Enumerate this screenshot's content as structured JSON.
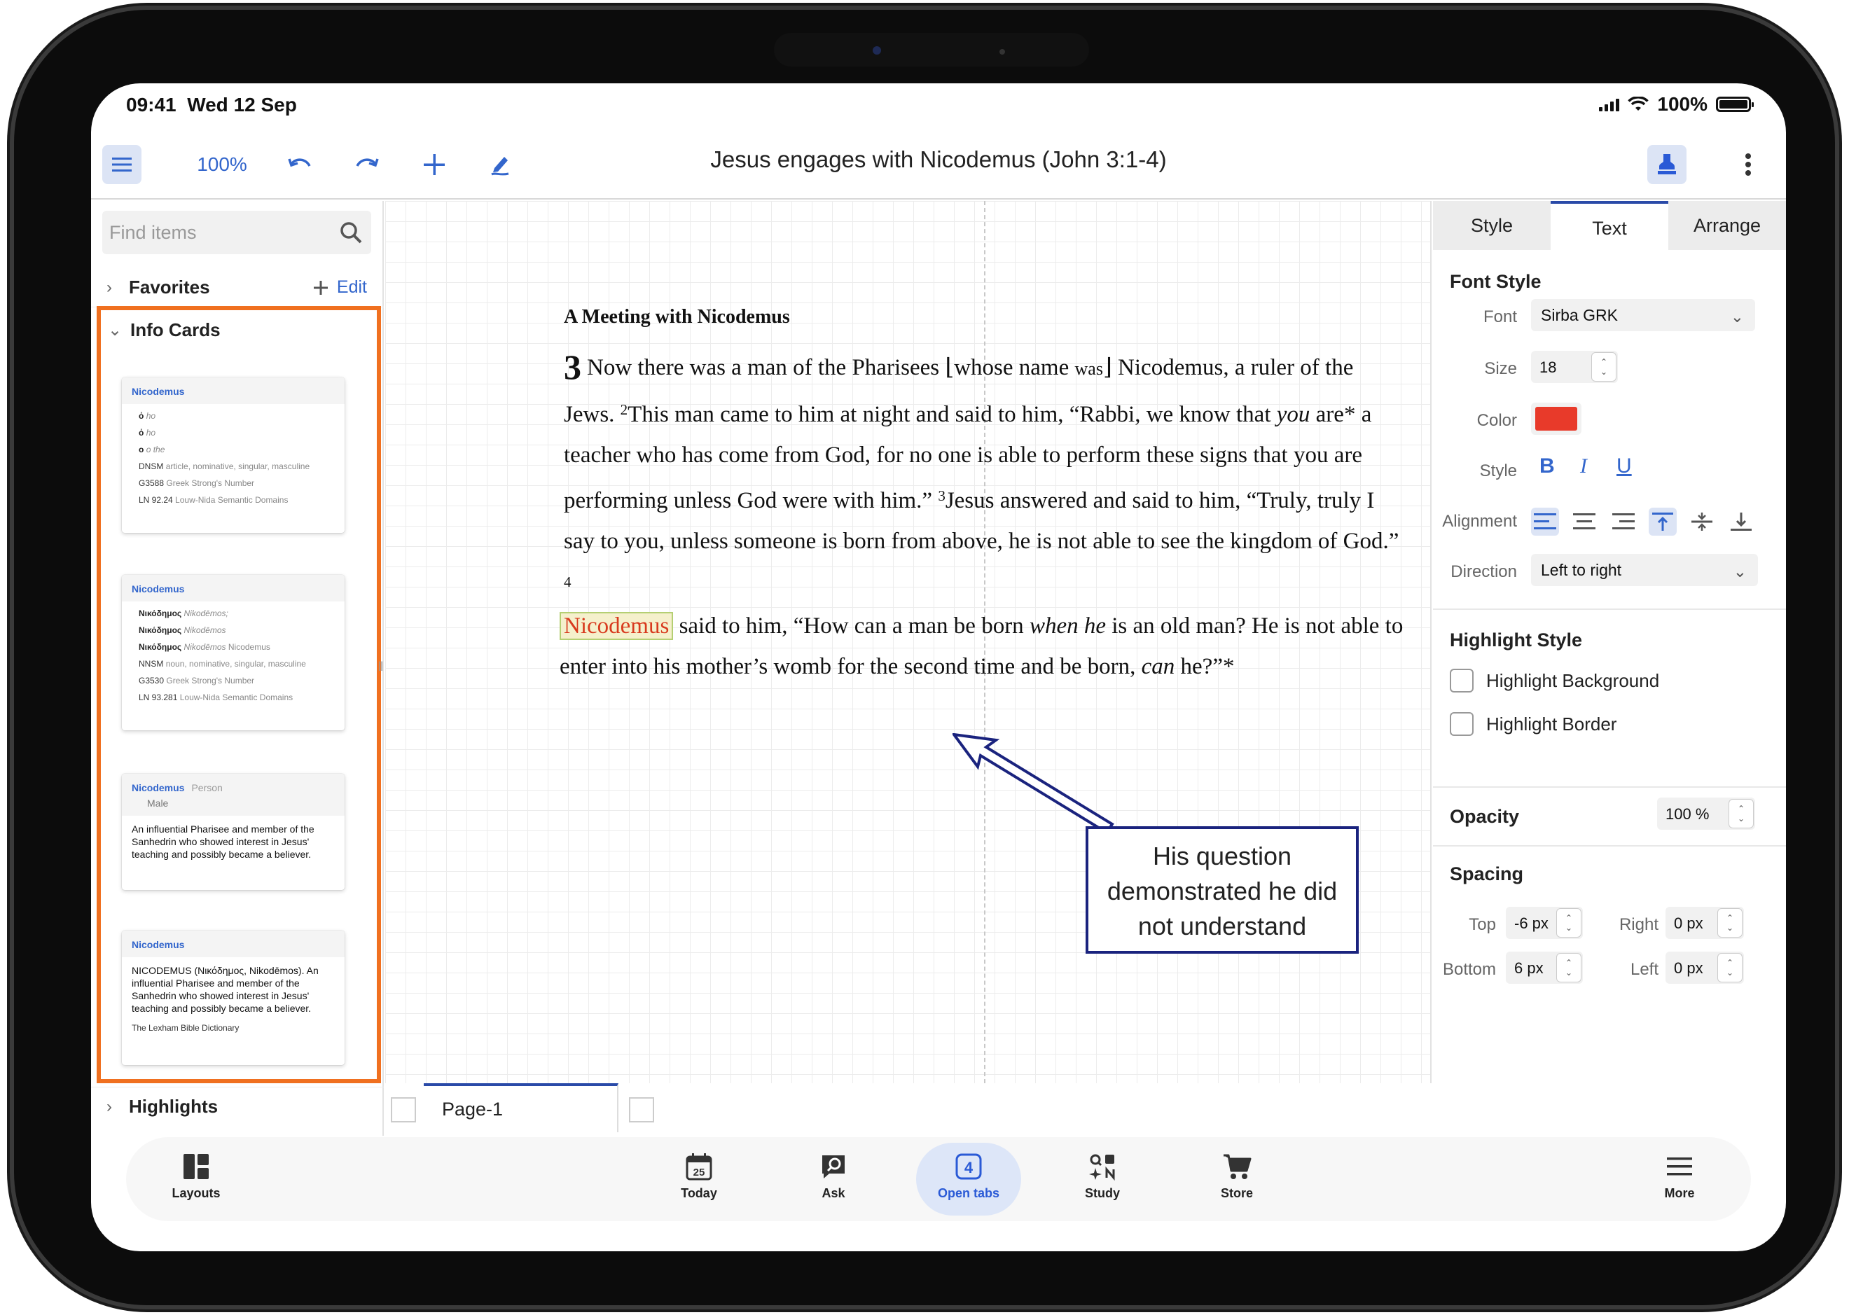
{
  "status": {
    "time": "09:41",
    "date": "Wed 12 Sep",
    "battery": "100%"
  },
  "toolbar": {
    "zoom": "100%",
    "title": "Jesus engages with Nicodemus (John 3:1-4)"
  },
  "sidebar": {
    "search_placeholder": "Find items",
    "favorites": "Favorites",
    "edit": "Edit",
    "info_cards": "Info Cards",
    "highlights": "Highlights",
    "cards": [
      {
        "name": "Nicodemus",
        "rows": [
          {
            "a": "ὁ",
            "b": "ho",
            "c": ""
          },
          {
            "a": "ὁ",
            "b": "ho",
            "c": ""
          },
          {
            "a": "ο",
            "b": "o the",
            "c": ""
          },
          {
            "a": "DNSM",
            "b": "",
            "c": "article, nominative, singular, masculine"
          },
          {
            "a": "G3588",
            "b": "",
            "c": "Greek Strong's Number"
          },
          {
            "a": "LN 92.24",
            "b": "",
            "c": "Louw-Nida Semantic Domains"
          }
        ]
      },
      {
        "name": "Nicodemus",
        "rows": [
          {
            "a": "Νικόδημος",
            "b": "Nikodēmos;",
            "c": ""
          },
          {
            "a": "Νικόδημος",
            "b": "Nikodēmos",
            "c": ""
          },
          {
            "a": "Νικόδημος",
            "b": "Nikodēmos",
            "c": "Nicodemus"
          },
          {
            "a": "NNSM",
            "b": "",
            "c": "noun, nominative, singular, masculine"
          },
          {
            "a": "G3530",
            "b": "",
            "c": "Greek Strong's Number"
          },
          {
            "a": "LN 93.281",
            "b": "",
            "c": "Louw-Nida Semantic Domains"
          }
        ]
      },
      {
        "name": "Nicodemus",
        "type": "Person",
        "sub": "Male",
        "text": "An influential Pharisee and member of the Sanhedrin who showed interest in Jesus' teaching and possibly became a believer."
      },
      {
        "name": "Nicodemus",
        "text": "NICODEMUS (Νικόδημος, Nikodēmos). An influential Pharisee and member of the Sanhedrin who showed interest in Jesus' teaching and possibly became a believer.",
        "source": "The Lexham Bible Dictionary"
      }
    ]
  },
  "scripture": {
    "heading": "A Meeting with Nicodemus",
    "chapter": "3",
    "p1_a": "Now there was a man of the Pharisees ⌊whose name ",
    "p1_was": "was",
    "p1_b": "⌋ Nicodemus, a ruler of the Jews. ",
    "v2": "2",
    "p1_c": "This man came to him at night and said to him, “Rabbi, we know that ",
    "you": "you",
    "p1_d": " are* a teacher who has come from God, for no one is able to perform these signs that you are performing unless God were with him.” ",
    "v3": "3",
    "p1_e": "Jesus answered and said to him, “Truly, truly I say to you, unless someone is born from above, he is not able to see the kingdom of God.” ",
    "v4": "4",
    "nico": "Nicodemus",
    "p2_a": " said to him, “How can a man be born ",
    "when_he": "when he",
    "p2_b": " is an old man? He is not able to enter into his mother’s womb for the second time and be born, ",
    "can": "can",
    "p2_c": " he?”*"
  },
  "callout": "His question demonstrated he did not understand",
  "pages": {
    "tab": "Page-1"
  },
  "panel": {
    "tabs": [
      "Style",
      "Text",
      "Arrange"
    ],
    "font_style": "Font Style",
    "font_label": "Font",
    "font_value": "Sirba GRK",
    "size_label": "Size",
    "size_value": "18",
    "color_label": "Color",
    "color_value": "#e83a2a",
    "style_label": "Style",
    "align_label": "Alignment",
    "dir_label": "Direction",
    "dir_value": "Left to right",
    "highlight_style": "Highlight Style",
    "hl_bg": "Highlight Background",
    "hl_border": "Highlight Border",
    "opacity_label": "Opacity",
    "opacity_value": "100 %",
    "spacing": "Spacing",
    "top_label": "Top",
    "top_value": "-6 px",
    "right_label": "Right",
    "right_value": "0 px",
    "bottom_label": "Bottom",
    "bottom_value": "6 px",
    "left_label": "Left",
    "left_value": "0 px"
  },
  "dock": {
    "layouts": "Layouts",
    "today": "Today",
    "today_day": "25",
    "ask": "Ask",
    "open_tabs": "Open tabs",
    "open_tabs_count": "4",
    "study": "Study",
    "store": "Store",
    "more": "More"
  }
}
